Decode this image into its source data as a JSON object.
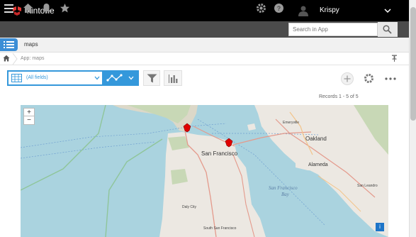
{
  "header": {
    "brand": "kintone",
    "user_name": "Krispy"
  },
  "navbar": {
    "search_placeholder": "Search in App"
  },
  "app": {
    "name": "maps"
  },
  "breadcrumb": {
    "text": "App: maps"
  },
  "view": {
    "selected": "(All fields)"
  },
  "records": {
    "text": "Records 1 - 5 of 5"
  },
  "map": {
    "zoom_in": "+",
    "zoom_out": "−",
    "attribution": "i",
    "labels": {
      "oakland": "Oakland",
      "san_francisco": "San Francisco",
      "alameda": "Alameda",
      "emeryville": "Emeryville",
      "san_francisco_bay": "San Francisco",
      "bay": "Bay",
      "san_leandro": "San Leandro",
      "daly_city": "Daly City",
      "south_sf": "South San Francisco"
    }
  },
  "colors": {
    "accent": "#3498db",
    "marker": "#e00000",
    "top_bar": "#000000",
    "nav_bar": "#4b4b4b"
  }
}
